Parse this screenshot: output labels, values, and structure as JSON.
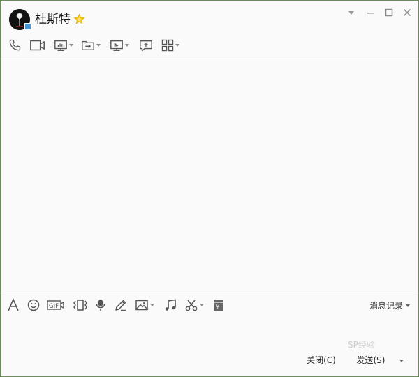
{
  "contact": {
    "name": "杜斯特",
    "star_icon": "star-icon",
    "avatar": "avatar",
    "status_color": "#4a9ad8"
  },
  "window_controls": [
    "dropdown-icon",
    "minimize-icon",
    "maximize-icon",
    "close-icon"
  ],
  "top_toolbar": {
    "items": [
      {
        "icon": "phone-icon",
        "has_caret": false
      },
      {
        "icon": "video-camera-icon",
        "has_caret": false
      },
      {
        "icon": "screen-share-icon",
        "has_caret": true
      },
      {
        "icon": "file-transfer-icon",
        "has_caret": true
      },
      {
        "icon": "remote-desktop-icon",
        "has_caret": true
      },
      {
        "icon": "add-chat-icon",
        "has_caret": false
      },
      {
        "icon": "apps-grid-icon",
        "has_caret": true
      }
    ]
  },
  "bottom_toolbar": {
    "items": [
      {
        "icon": "font-icon"
      },
      {
        "icon": "emoji-icon"
      },
      {
        "icon": "gif-icon",
        "label": "GIF"
      },
      {
        "icon": "shake-icon"
      },
      {
        "icon": "voice-icon"
      },
      {
        "icon": "pen-icon"
      },
      {
        "icon": "image-icon",
        "has_caret": true
      },
      {
        "icon": "music-icon"
      },
      {
        "icon": "screenshot-scissors-icon",
        "has_caret": true
      },
      {
        "icon": "red-packet-icon",
        "label": "¥"
      }
    ],
    "history_label": "消息记录"
  },
  "actions": {
    "close_label": "关闭(C)",
    "send_label": "发送(S)"
  },
  "watermark": "SP经验",
  "colors": {
    "window_bg": "#fafafa",
    "icon": "#555555",
    "star": "#f5c518",
    "border": "#e3e3e3"
  }
}
